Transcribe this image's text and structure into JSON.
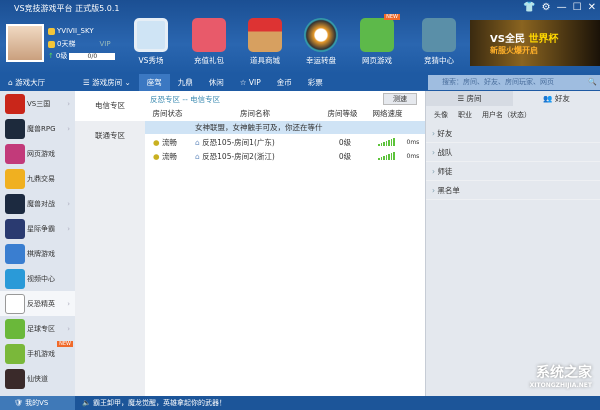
{
  "app": {
    "title": "VS竞技游戏平台 正式版5.0.1"
  },
  "window_controls": [
    "skin",
    "settings",
    "minimize",
    "maximize",
    "close"
  ],
  "user": {
    "name": "YVIVII_SKY",
    "ladder": "0天梯",
    "vip": "VIP",
    "level": "0级",
    "xp": "0/0"
  },
  "tools": [
    {
      "label": "VS秀场"
    },
    {
      "label": "充值礼包"
    },
    {
      "label": "道具商城"
    },
    {
      "label": "幸运转盘"
    },
    {
      "label": "网页游戏",
      "badge": "NEW"
    },
    {
      "label": "竞猜中心"
    }
  ],
  "banner": {
    "text1": "VS全民",
    "text2": "世界杯",
    "text3": "新服火爆开启"
  },
  "nav": [
    {
      "label": "游戏大厅"
    },
    {
      "label": "游戏房间"
    },
    {
      "label": "座驾"
    },
    {
      "label": "九鼎"
    },
    {
      "label": "休闲"
    },
    {
      "label": "VIP"
    },
    {
      "label": "金币"
    },
    {
      "label": "彩票"
    }
  ],
  "search": {
    "placeholder": "搜索：房间、好友、房间玩家、网页"
  },
  "sidebar": [
    {
      "label": "VS三国"
    },
    {
      "label": "魔兽RPG"
    },
    {
      "label": "网页游戏"
    },
    {
      "label": "九鼎交易"
    },
    {
      "label": "魔兽对战"
    },
    {
      "label": "星际争霸"
    },
    {
      "label": "棋牌游戏"
    },
    {
      "label": "视频中心"
    },
    {
      "label": "反恐精英"
    },
    {
      "label": "足球专区"
    },
    {
      "label": "手机游戏",
      "badge": "NEW"
    },
    {
      "label": "仙侠道"
    }
  ],
  "zones": [
    {
      "label": "电信专区"
    },
    {
      "label": "联通专区"
    }
  ],
  "main": {
    "breadcrumb": "反恐专区 -- 电信专区",
    "speed_button": "测速",
    "columns": [
      "房间状态",
      "房间名称",
      "房间等级",
      "网络速度"
    ],
    "announcement": "女神联盟，女神触手可及，你还在等什",
    "rooms": [
      {
        "status": "流畅",
        "name": "反恐105-房间1(广东)",
        "level": "0级",
        "ping": "0ms"
      },
      {
        "status": "流畅",
        "name": "反恐105-房间2(浙江)",
        "level": "0级",
        "ping": "0ms"
      }
    ]
  },
  "right": {
    "tabs": [
      "房间",
      "好友"
    ],
    "columns": [
      "头像",
      "职业",
      "用户名（状态）"
    ],
    "groups": [
      "好友",
      "战队",
      "师徒",
      "黑名单"
    ]
  },
  "status": {
    "my_vs": "我的VS",
    "notice": "霸王卸甲，魔龙觉醒，英雄拿起你的武器！"
  },
  "watermark": {
    "text": "系统之家",
    "url": "XITONGZHIJIA.NET"
  }
}
